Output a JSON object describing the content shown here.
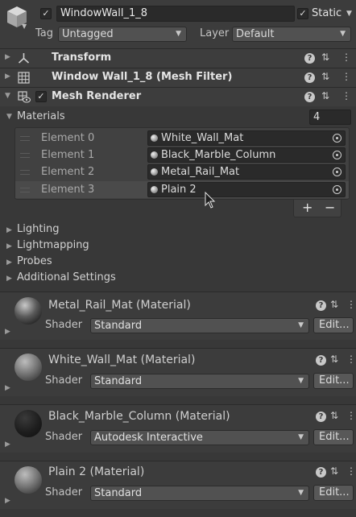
{
  "header": {
    "object_name": "WindowWall_1_8",
    "static_label": "Static",
    "tag_label": "Tag",
    "tag_value": "Untagged",
    "layer_label": "Layer",
    "layer_value": "Default"
  },
  "components": {
    "transform": "Transform",
    "mesh_filter": "Window Wall_1_8 (Mesh Filter)",
    "mesh_renderer": "Mesh Renderer"
  },
  "materials": {
    "label": "Materials",
    "count": "4",
    "elements": [
      {
        "label": "Element 0",
        "value": "White_Wall_Mat"
      },
      {
        "label": "Element 1",
        "value": "Black_Marble_Column"
      },
      {
        "label": "Element 2",
        "value": "Metal_Rail_Mat"
      },
      {
        "label": "Element 3",
        "value": "Plain 2"
      }
    ],
    "plus": "+",
    "minus": "−"
  },
  "sections": [
    "Lighting",
    "Lightmapping",
    "Probes",
    "Additional Settings"
  ],
  "material_blocks": [
    {
      "title": "Metal_Rail_Mat (Material)",
      "shader_label": "Shader",
      "shader": "Standard",
      "edit": "Edit..."
    },
    {
      "title": "White_Wall_Mat (Material)",
      "shader_label": "Shader",
      "shader": "Standard",
      "edit": "Edit..."
    },
    {
      "title": "Black_Marble_Column (Material)",
      "shader_label": "Shader",
      "shader": "Autodesk Interactive",
      "edit": "Edit..."
    },
    {
      "title": "Plain 2 (Material)",
      "shader_label": "Shader",
      "shader": "Standard",
      "edit": "Edit..."
    }
  ],
  "icons": {
    "help": "?",
    "settings": "⇅",
    "more": "⋮"
  },
  "colors": {
    "panel_bg": "#383838",
    "header_bg": "#3c3c3c",
    "field_bg": "#2a2a2a",
    "selected_row": "#4a4a4a"
  }
}
